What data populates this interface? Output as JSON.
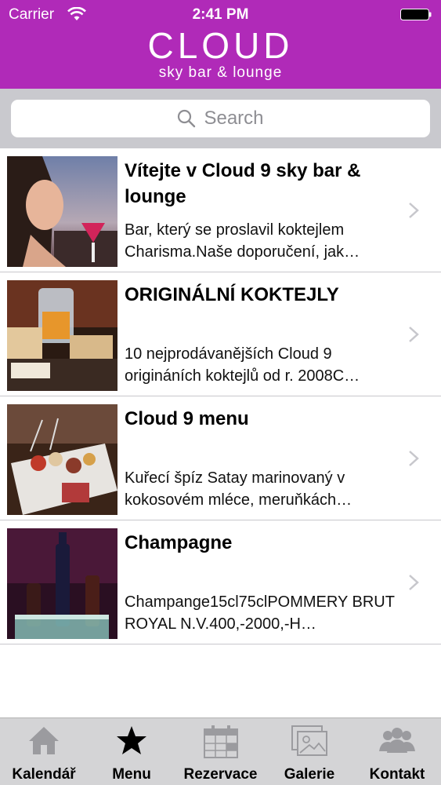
{
  "status_bar": {
    "carrier": "Carrier",
    "time": "2:41 PM"
  },
  "header": {
    "logo_word": "CLOUD",
    "logo_tagline": "sky bar & lounge",
    "brand_color": "#b02ab8"
  },
  "search": {
    "placeholder": "Search"
  },
  "list": [
    {
      "title": "Vítejte v Cloud 9 sky bar & lounge",
      "description": "Bar, který se proslavil koktejlem Charisma.Naše doporučení, jak…"
    },
    {
      "title": "ORIGINÁLNÍ KOKTEJLY",
      "description": "10 nejprodávanějších Cloud 9 origináních koktejlů od r. 2008C…"
    },
    {
      "title": "Cloud 9 menu",
      "description": "Kuřecí špíz Satay marinovaný v kokosovém mléce, meruňkách…"
    },
    {
      "title": "Champagne",
      "description": "Champange15cl75clPOMMERY BRUT ROYAL N.V.400,-2000,-H…"
    }
  ],
  "tabs": [
    {
      "label": "Kalendář",
      "icon": "home-icon"
    },
    {
      "label": "Menu",
      "icon": "star-icon",
      "selected": true
    },
    {
      "label": "Rezervace",
      "icon": "calendar-icon"
    },
    {
      "label": "Galerie",
      "icon": "gallery-icon"
    },
    {
      "label": "Kontakt",
      "icon": "people-icon"
    }
  ]
}
